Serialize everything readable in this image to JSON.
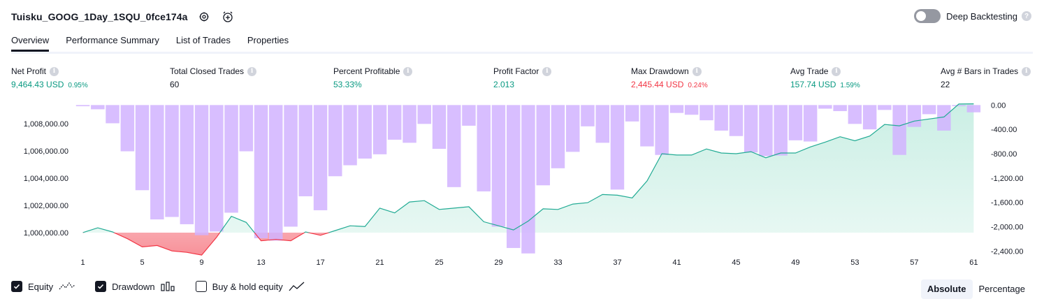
{
  "header": {
    "strategy_name": "Tuisku_GOOG_1Day_1SQU_0fce174a",
    "settings_icon": "gear-icon",
    "alert_icon": "add-alert-icon",
    "deep_backtesting_label": "Deep Backtesting",
    "deep_backtesting_on": false
  },
  "tabs": [
    {
      "label": "Overview",
      "active": true
    },
    {
      "label": "Performance Summary",
      "active": false
    },
    {
      "label": "List of Trades",
      "active": false
    },
    {
      "label": "Properties",
      "active": false
    }
  ],
  "metrics": {
    "net_profit": {
      "label": "Net Profit",
      "value": "9,464.43 USD",
      "pct": "0.95%"
    },
    "total_closed_trades": {
      "label": "Total Closed Trades",
      "value": "60"
    },
    "percent_profitable": {
      "label": "Percent Profitable",
      "value": "53.33%"
    },
    "profit_factor": {
      "label": "Profit Factor",
      "value": "2.013"
    },
    "max_drawdown": {
      "label": "Max Drawdown",
      "value": "2,445.44 USD",
      "pct": "0.24%"
    },
    "avg_trade": {
      "label": "Avg Trade",
      "value": "157.74 USD",
      "pct": "1.59%"
    },
    "avg_bars": {
      "label": "Avg # Bars in Trades",
      "value": "22"
    }
  },
  "legend": {
    "equity": {
      "label": "Equity",
      "checked": true
    },
    "drawdown": {
      "label": "Drawdown",
      "checked": true
    },
    "buy_hold": {
      "label": "Buy & hold equity",
      "checked": false
    }
  },
  "mode": {
    "absolute": "Absolute",
    "percentage": "Percentage",
    "selected": "Absolute"
  },
  "colors": {
    "green": "#089981",
    "red": "#f23645",
    "drawdown_bar": "#d1b3ff",
    "equity_fill": "#c8eee3",
    "equity_line": "#22ab94"
  },
  "chart_data": {
    "type": "line",
    "x": [
      1,
      2,
      3,
      4,
      5,
      6,
      7,
      8,
      9,
      10,
      11,
      12,
      13,
      14,
      15,
      16,
      17,
      18,
      19,
      20,
      21,
      22,
      23,
      24,
      25,
      26,
      27,
      28,
      29,
      30,
      31,
      32,
      33,
      34,
      35,
      36,
      37,
      38,
      39,
      40,
      41,
      42,
      43,
      44,
      45,
      46,
      47,
      48,
      49,
      50,
      51,
      52,
      53,
      54,
      55,
      56,
      57,
      58,
      59,
      60,
      61
    ],
    "x_tick_labels": [
      "1",
      "5",
      "9",
      "13",
      "17",
      "21",
      "25",
      "29",
      "33",
      "37",
      "41",
      "45",
      "49",
      "53",
      "57",
      "61"
    ],
    "left_axis": {
      "tick_labels": [
        "1,000,000.00",
        "1,002,000.00",
        "1,004,000.00",
        "1,006,000.00",
        "1,008,000.00"
      ],
      "ylim": [
        998200,
        1009600
      ]
    },
    "right_axis": {
      "tick_labels": [
        "0.00",
        "-400.00",
        "-800.00",
        "-1,200.00",
        "-1,600.00",
        "-2,000.00",
        "-2,400.00"
      ],
      "ylim": [
        -2500,
        50
      ]
    },
    "series": [
      {
        "name": "Equity",
        "axis": "left",
        "values": [
          1000000,
          1000350,
          1000050,
          999550,
          998950,
          999050,
          998650,
          998550,
          998350,
          999650,
          1001200,
          1000750,
          999400,
          999500,
          999400,
          1000050,
          999800,
          1000150,
          1000500,
          1000450,
          1001800,
          1001450,
          1002250,
          1002350,
          1001700,
          1001800,
          1001900,
          1000800,
          1000500,
          1000200,
          1000850,
          1001750,
          1001700,
          1002100,
          1002200,
          1002800,
          1002750,
          1002550,
          1003800,
          1005800,
          1005700,
          1005700,
          1006150,
          1005850,
          1005800,
          1005950,
          1005500,
          1005850,
          1005850,
          1006300,
          1006650,
          1007050,
          1006750,
          1007100,
          1007950,
          1007850,
          1008200,
          1008350,
          1008500,
          1009450,
          1009464
        ]
      },
      {
        "name": "Drawdown",
        "axis": "right",
        "type": "bar",
        "values": [
          -20,
          -70,
          -300,
          -760,
          -1400,
          -1880,
          -1840,
          -1960,
          -2140,
          -2080,
          -1770,
          -760,
          -2190,
          -2230,
          -2000,
          -1500,
          -1730,
          -1170,
          -990,
          -880,
          -810,
          -570,
          -620,
          -310,
          -720,
          -1350,
          -340,
          -1420,
          -2000,
          -2350,
          -2440,
          -1320,
          -1040,
          -770,
          -350,
          -620,
          -1390,
          -270,
          -680,
          -820,
          -130,
          -160,
          -250,
          -420,
          -510,
          -780,
          -840,
          -830,
          -580,
          -600,
          -60,
          -100,
          -310,
          -400,
          -80,
          -820,
          -360,
          -150,
          -420,
          -20,
          -120
        ]
      }
    ]
  }
}
